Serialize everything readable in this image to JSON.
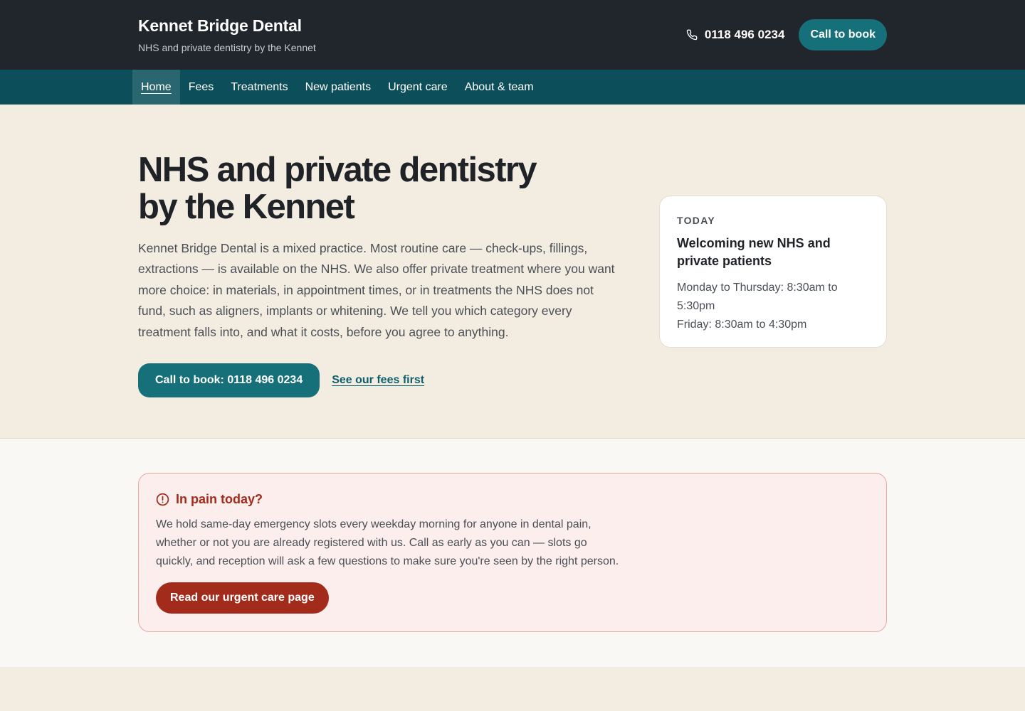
{
  "header": {
    "brand_name": "Kennet Bridge Dental",
    "tagline": "NHS and private dentistry by the Kennet",
    "phone": "0118 496 0234",
    "call_button": "Call to book",
    "phone_icon": "phone-icon"
  },
  "nav": {
    "items": [
      {
        "label": "Home",
        "active": true
      },
      {
        "label": "Fees"
      },
      {
        "label": "Treatments"
      },
      {
        "label": "New patients"
      },
      {
        "label": "Urgent care"
      },
      {
        "label": "About & team"
      }
    ]
  },
  "hero": {
    "title": "NHS and private dentistry by the Kennet",
    "lead": "Kennet Bridge Dental is a mixed practice. Most routine care — check-ups, fillings, extractions — is available on the NHS. We also offer private treatment where you want more choice: in materials, in appointment times, or in treatments the NHS does not fund, such as aligners, implants or whitening. We tell you which category every treatment falls into, and what it costs, before you agree to anything.",
    "primary_button": "Call to book: 0118 496 0234",
    "secondary_link": "See our fees first"
  },
  "today": {
    "eyebrow": "TODAY",
    "title": "Welcoming new NHS and private patients",
    "hours": [
      "Monday to Thursday: 8:30am to 5:30pm",
      "Friday: 8:30am to 4:30pm"
    ]
  },
  "urgent": {
    "icon": "alert-circle-icon",
    "title": "In pain today?",
    "text": "We hold same-day emergency slots every weekday morning for anyone in dental pain, whether or not you are already registered with us. Call as early as you can — slots go quickly, and reception will ask a few questions to make sure you're seen by the right person.",
    "button": "Read our urgent care page"
  },
  "colors": {
    "header_bg": "#21252c",
    "nav_bg": "#0c4f5b",
    "accent": "#16707a",
    "urgent": "#a32b1c",
    "hero_bg": "#f3ece1"
  }
}
